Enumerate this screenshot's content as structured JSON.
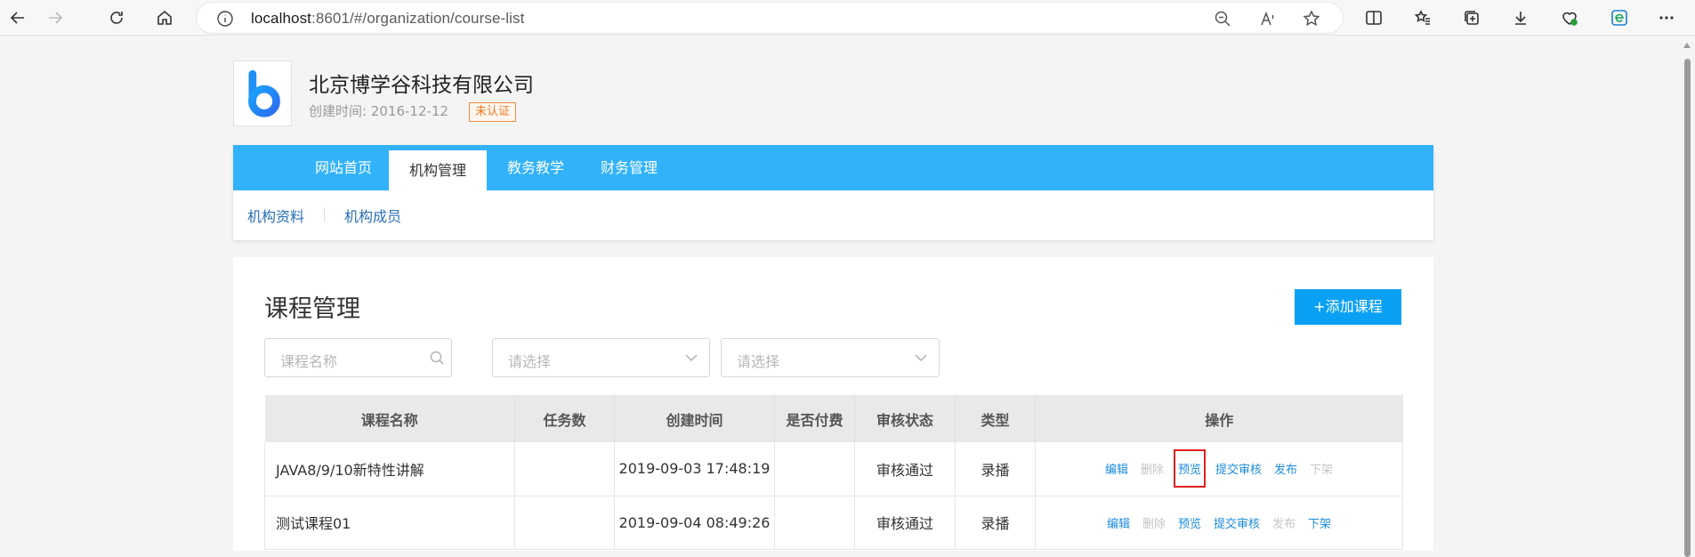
{
  "browser": {
    "url_host": "localhost",
    "url_rest": ":8601/#/organization/course-list"
  },
  "org": {
    "name": "北京博学谷科技有限公司",
    "created_label": "创建时间:",
    "created_date": "2016-12-12",
    "badge": "未认证"
  },
  "nav": {
    "tabs": [
      {
        "label": "网站首页"
      },
      {
        "label": "机构管理"
      },
      {
        "label": "教务教学"
      },
      {
        "label": "财务管理"
      }
    ],
    "subnav": [
      {
        "label": "机构资料"
      },
      {
        "label": "机构成员"
      }
    ]
  },
  "main": {
    "title": "课程管理",
    "add_button": "+添加课程",
    "search_placeholder": "课程名称",
    "select1_placeholder": "请选择",
    "select2_placeholder": "请选择"
  },
  "table": {
    "headers": [
      "课程名称",
      "任务数",
      "创建时间",
      "是否付费",
      "审核状态",
      "类型",
      "操作"
    ],
    "rows": [
      {
        "name": "JAVA8/9/10新特性讲解",
        "tasks": "",
        "created": "2019-09-03 17:48:19",
        "paid": "",
        "status": "审核通过",
        "type": "录播",
        "ops": [
          "编辑",
          "删除",
          "预览",
          "提交审核",
          "发布",
          "下架"
        ]
      },
      {
        "name": "测试课程01",
        "tasks": "",
        "created": "2019-09-04 08:49:26",
        "paid": "",
        "status": "审核通过",
        "type": "录播",
        "ops": [
          "编辑",
          "删除",
          "预览",
          "提交审核",
          "发布",
          "下架"
        ]
      }
    ]
  },
  "colors": {
    "nav_bar": "#31b2fb",
    "add_button": "#0aa1f5",
    "link": "#1a8be0",
    "disabled": "#c4c4c4",
    "badge": "#f07a22",
    "highlight_box": "#e02020"
  }
}
